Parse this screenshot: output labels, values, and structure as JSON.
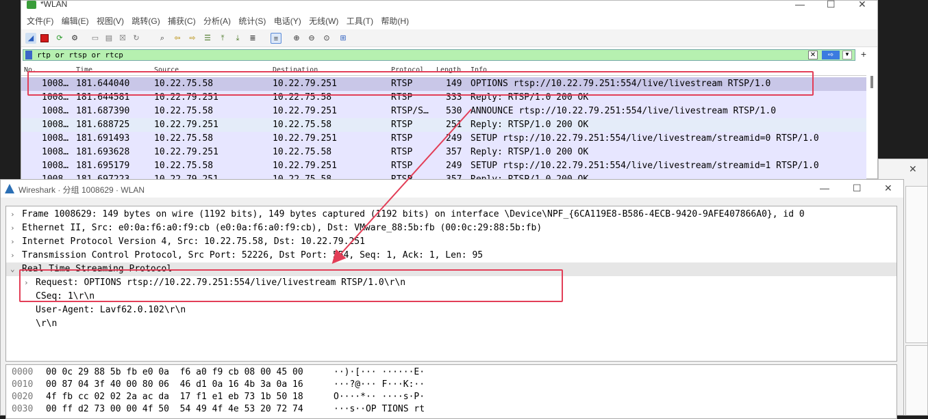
{
  "main_window": {
    "title": "*WLAN",
    "menus": [
      "文件(F)",
      "编辑(E)",
      "视图(V)",
      "跳转(G)",
      "捕获(C)",
      "分析(A)",
      "统计(S)",
      "电话(Y)",
      "无线(W)",
      "工具(T)",
      "帮助(H)"
    ],
    "filter": {
      "value": "rtp or rtsp or rtcp",
      "apply_label": "⇨",
      "clear_label": "✕",
      "add_label": "+"
    },
    "columns": [
      "No.",
      "Time",
      "Source",
      "Destination",
      "Protocol",
      "Length",
      "Info"
    ],
    "packets": [
      {
        "no": "1008…",
        "time": "181.644040",
        "src": "10.22.75.58",
        "dst": "10.22.79.251",
        "proto": "RTSP",
        "len": "149",
        "info": "OPTIONS rtsp://10.22.79.251:554/live/livestream RTSP/1.0"
      },
      {
        "no": "1008…",
        "time": "181.644581",
        "src": "10.22.79.251",
        "dst": "10.22.75.58",
        "proto": "RTSP",
        "len": "333",
        "info": "Reply: RTSP/1.0 200 OK"
      },
      {
        "no": "1008…",
        "time": "181.687390",
        "src": "10.22.75.58",
        "dst": "10.22.79.251",
        "proto": "RTSP/S…",
        "len": "530",
        "info": "ANNOUNCE rtsp://10.22.79.251:554/live/livestream RTSP/1.0"
      },
      {
        "no": "1008…",
        "time": "181.688725",
        "src": "10.22.79.251",
        "dst": "10.22.75.58",
        "proto": "RTSP",
        "len": "251",
        "info": "Reply: RTSP/1.0 200 OK"
      },
      {
        "no": "1008…",
        "time": "181.691493",
        "src": "10.22.75.58",
        "dst": "10.22.79.251",
        "proto": "RTSP",
        "len": "249",
        "info": "SETUP rtsp://10.22.79.251:554/live/livestream/streamid=0 RTSP/1.0"
      },
      {
        "no": "1008…",
        "time": "181.693628",
        "src": "10.22.79.251",
        "dst": "10.22.75.58",
        "proto": "RTSP",
        "len": "357",
        "info": "Reply: RTSP/1.0 200 OK"
      },
      {
        "no": "1008…",
        "time": "181.695179",
        "src": "10.22.75.58",
        "dst": "10.22.79.251",
        "proto": "RTSP",
        "len": "249",
        "info": "SETUP rtsp://10.22.79.251:554/live/livestream/streamid=1 RTSP/1.0"
      },
      {
        "no": "1008…",
        "time": "181.697223",
        "src": "10.22.79.251",
        "dst": "10.22.75.58",
        "proto": "RTSP",
        "len": "357",
        "info": "Reply: RTSP/1.0 200 OK"
      }
    ]
  },
  "dialog": {
    "title": "Wireshark · 分组 1008629 · WLAN",
    "tree": [
      {
        "caret": "›",
        "text": "Frame 1008629: 149 bytes on wire (1192 bits), 149 bytes captured (1192 bits) on interface \\Device\\NPF_{6CA119E8-B586-4ECB-9420-9AFE407866A0}, id 0"
      },
      {
        "caret": "›",
        "text": "Ethernet II, Src: e0:0a:f6:a0:f9:cb (e0:0a:f6:a0:f9:cb), Dst: VMware_88:5b:fb (00:0c:29:88:5b:fb)"
      },
      {
        "caret": "›",
        "text": "Internet Protocol Version 4, Src: 10.22.75.58, Dst: 10.22.79.251"
      },
      {
        "caret": "›",
        "text": "Transmission Control Protocol, Src Port: 52226, Dst Port: 554, Seq: 1, Ack: 1, Len: 95"
      },
      {
        "caret": "⌄",
        "text": "Real Time Streaming Protocol"
      },
      {
        "caret": "›",
        "text": "Request: OPTIONS rtsp://10.22.79.251:554/live/livestream RTSP/1.0\\r\\n"
      },
      {
        "caret": "",
        "text": "CSeq: 1\\r\\n"
      },
      {
        "caret": "",
        "text": "User-Agent: Lavf62.0.102\\r\\n"
      },
      {
        "caret": "",
        "text": "\\r\\n"
      }
    ],
    "hex": [
      {
        "offset": "0000",
        "bytes": "00 0c 29 88 5b fb e0 0a  f6 a0 f9 cb 08 00 45 00",
        "ascii": "··)·[··· ······E·"
      },
      {
        "offset": "0010",
        "bytes": "00 87 04 3f 40 00 80 06  46 d1 0a 16 4b 3a 0a 16",
        "ascii": "···?@··· F···K:··"
      },
      {
        "offset": "0020",
        "bytes": "4f fb cc 02 02 2a ac da  17 f1 e1 eb 73 1b 50 18",
        "ascii": "O····*·· ····s·P·"
      },
      {
        "offset": "0030",
        "bytes": "00 ff d2 73 00 00 4f 50  54 49 4f 4e 53 20 72 74",
        "ascii": "···s··OP TIONS rt"
      }
    ]
  },
  "colors": {
    "annotation": "#e23e57",
    "row_bg": "#e7e6ff",
    "row_selected": "#c9c7e8",
    "filter_ok": "#b6f0b0"
  }
}
